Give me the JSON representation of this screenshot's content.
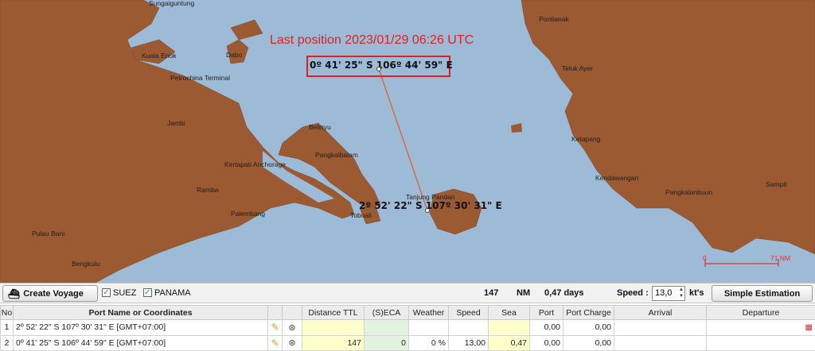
{
  "map": {
    "last_position_title": "Last position 2023/01/29 06:26 UTC",
    "last_position_coord": "0º 41' 25\" S  106º 44' 59\" E",
    "start_coord": "2º 52' 22\" S  107º 30' 31\" E",
    "scale_start": "0",
    "scale_end": "71 NM",
    "route_color": "#e06030",
    "land_color": "#9b5a31",
    "sea_color": "#9dbad6",
    "places": [
      "Sungaiguntung",
      "Kuala Enok",
      "Dabo",
      "Petrochina Terminal",
      "Jambi",
      "Belinyu",
      "Pangkalbalam",
      "Kertapati Anchorage",
      "Ramba",
      "Palembang",
      "Pulau Bani",
      "Bengkulu",
      "Toboali",
      "Tanjung Pandan",
      "Pontianak",
      "Teluk Ayer",
      "Ketapang",
      "Kendawangan",
      "Pangkalanbuun",
      "Sampit"
    ]
  },
  "toolbar": {
    "create_voyage_label": "Create Voyage",
    "suez_label": "SUEZ",
    "panama_label": "PANAMA",
    "distance_value": "147",
    "distance_unit": "NM",
    "days_value": "0,47 days",
    "speed_label": "Speed :",
    "speed_value": "13,0",
    "speed_unit": "kt's",
    "simple_estimation_label": "Simple Estimation"
  },
  "table": {
    "headers": [
      "No",
      "Port Name or Coordinates",
      "",
      "",
      "Distance TTL",
      "(S)ECA",
      "Weather",
      "Speed",
      "Sea",
      "Port",
      "Port Charge",
      "Arrival",
      "Departure"
    ],
    "rows": [
      {
        "no": "1",
        "name": "2º 52' 22\" S  107º 30' 31\" E [GMT+07:00]",
        "distance": "",
        "seca": "",
        "weather": "",
        "speed": "",
        "sea": "",
        "port": "0,00",
        "port_charge": "0,00",
        "arrival": "",
        "departure": ""
      },
      {
        "no": "2",
        "name": "0º 41' 25\" S  106º 44' 59\" E [GMT+07:00]",
        "distance": "147",
        "seca": "0",
        "weather": "0 %",
        "speed": "13,00",
        "sea": "0,47",
        "port": "0,00",
        "port_charge": "0,00",
        "arrival": "",
        "departure": ""
      }
    ]
  }
}
